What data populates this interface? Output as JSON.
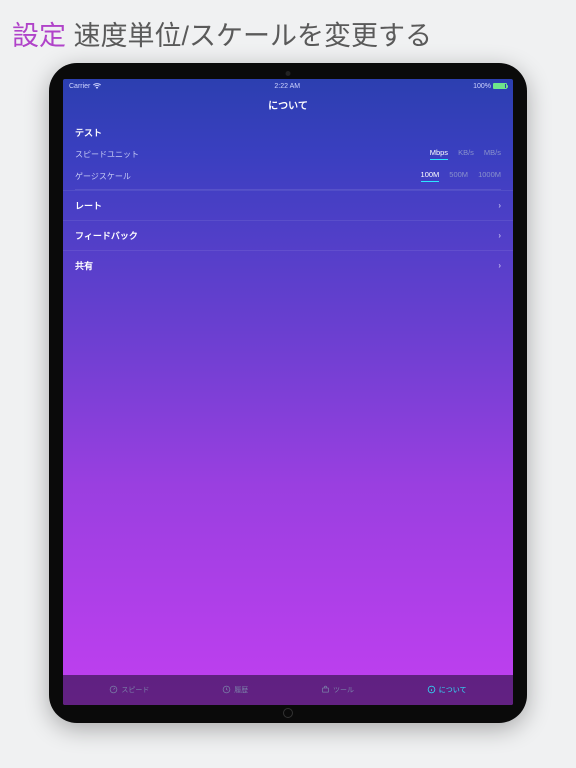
{
  "headline": {
    "accent": "設定",
    "rest": " 速度単位/スケールを変更する"
  },
  "status": {
    "carrier": "Carrier",
    "time": "2:22 AM",
    "battery": "100%"
  },
  "nav": {
    "title": "について"
  },
  "section_test": {
    "header": "テスト",
    "speed_unit_label": "スピードユニット",
    "speed_unit_options": [
      "Mbps",
      "KB/s",
      "MB/s"
    ],
    "speed_unit_selected": 0,
    "gauge_scale_label": "ゲージスケール",
    "gauge_scale_options": [
      "100M",
      "500M",
      "1000M"
    ],
    "gauge_scale_selected": 0
  },
  "links": {
    "rate": "レート",
    "feedback": "フィードバック",
    "share": "共有"
  },
  "tabs": {
    "speed": "スピード",
    "history": "履歴",
    "tools": "ツール",
    "about": "について"
  }
}
